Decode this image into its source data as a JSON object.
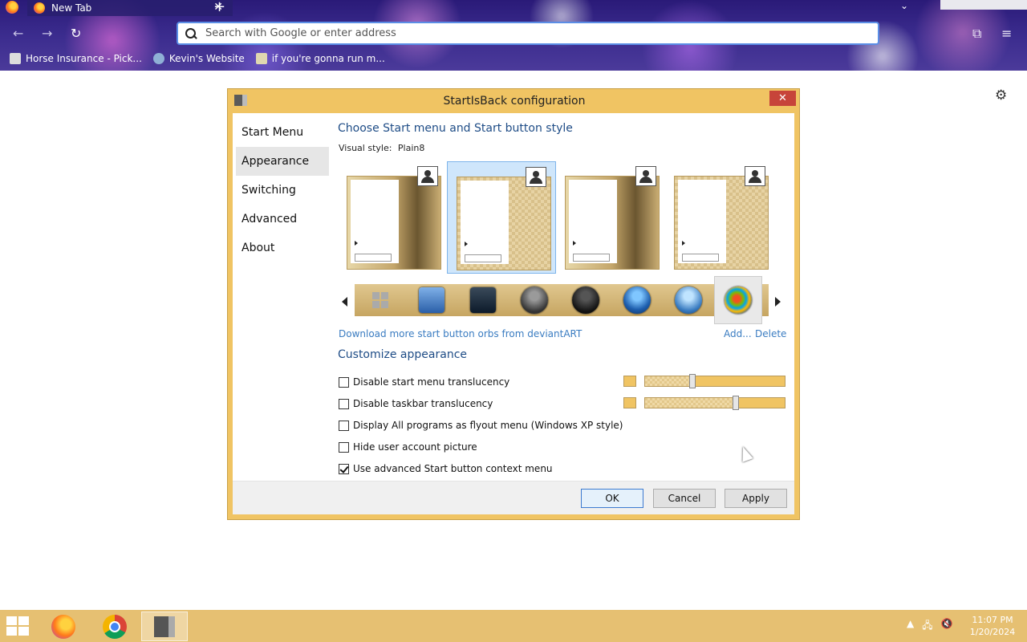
{
  "browser": {
    "tab_title": "New Tab",
    "tab_close": "✕",
    "new_tab": "+",
    "address_placeholder": "Search with Google or enter address",
    "bookmarks": [
      {
        "label": "Horse Insurance - Pick..."
      },
      {
        "label": "Kevin's Website"
      },
      {
        "label": "if you're gonna run m..."
      }
    ]
  },
  "dialog": {
    "title": "StartIsBack configuration",
    "close": "✕",
    "nav": [
      {
        "label": "Start Menu"
      },
      {
        "label": "Appearance"
      },
      {
        "label": "Switching"
      },
      {
        "label": "Advanced"
      },
      {
        "label": "About"
      }
    ],
    "active_nav": "Appearance",
    "section_style": "Choose Start menu and Start button style",
    "visual_style_label": "Visual style:",
    "visual_style_value": "Plain8",
    "selected_style_index": 1,
    "selected_orb_index": 7,
    "download_link": "Download more start button orbs from deviantART",
    "add_link": "Add...",
    "delete_link": "Delete",
    "section_customize": "Customize appearance",
    "options": [
      {
        "label": "Disable start menu translucency",
        "checked": false
      },
      {
        "label": "Disable taskbar translucency",
        "checked": false
      },
      {
        "label": "Display All programs as flyout menu (Windows XP style)",
        "checked": false
      },
      {
        "label": "Hide user account picture",
        "checked": false
      },
      {
        "label": "Use advanced Start button context menu",
        "checked": true
      }
    ],
    "sliders": [
      {
        "level": 0.34
      },
      {
        "level": 0.65
      }
    ],
    "accent_color": "#f0c463",
    "buttons": {
      "ok": "OK",
      "cancel": "Cancel",
      "apply": "Apply"
    }
  },
  "taskbar": {
    "time": "11:07 PM",
    "date": "1/20/2024",
    "color": "#e6c072"
  }
}
